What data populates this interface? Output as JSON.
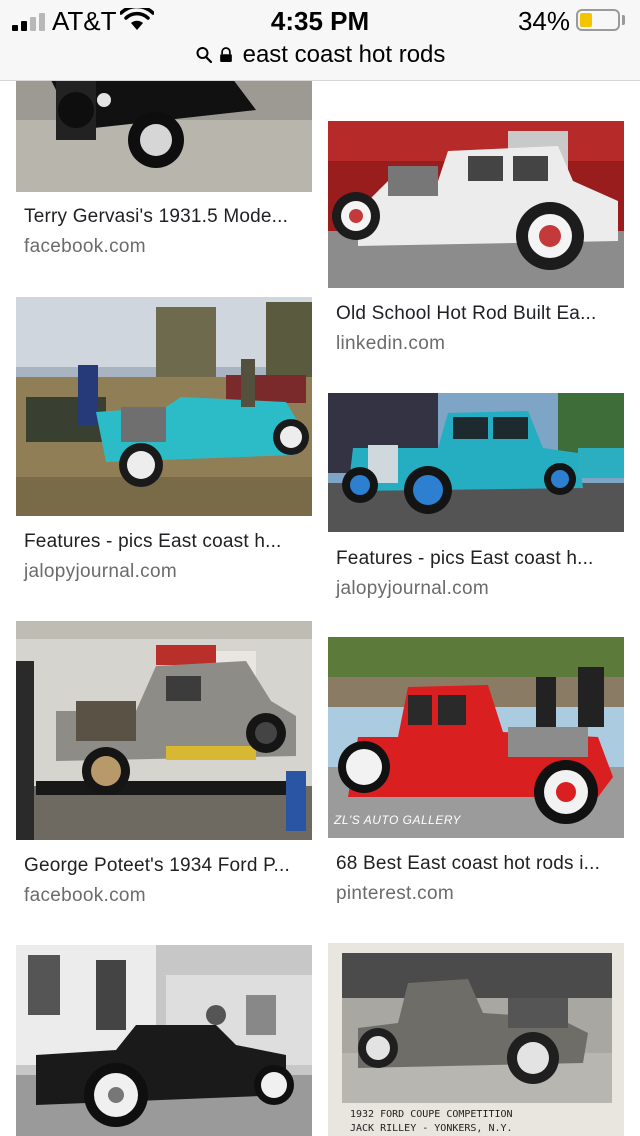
{
  "status_bar": {
    "carrier": "AT&T",
    "time": "4:35 PM",
    "battery_percent": "34%",
    "battery_level": 0.34,
    "battery_color": "#f5c400",
    "signal_bars_active": 2,
    "signal_bars_total": 4,
    "icons": [
      "signal-bars-icon",
      "wifi-icon",
      "battery-icon"
    ]
  },
  "url_bar": {
    "text": "east coast hot rods",
    "icons": [
      "search-icon",
      "lock-icon"
    ]
  },
  "results": [
    {
      "title": "Terry Gervasi's 1931.5 Mode...",
      "source": "facebook.com"
    },
    {
      "title": "Old School Hot Rod Built Ea...",
      "source": "linkedin.com"
    },
    {
      "title": "Features - pics East coast h...",
      "source": "jalopyjournal.com"
    },
    {
      "title": "Features - pics East coast h...",
      "source": "jalopyjournal.com"
    },
    {
      "title": "George Poteet's 1934 Ford P...",
      "source": "facebook.com"
    },
    {
      "title": "68 Best East coast hot rods i...",
      "source": "pinterest.com"
    },
    {
      "title": "",
      "source": ""
    },
    {
      "title": "",
      "source": "",
      "image_caption": [
        "1932 FORD COUPE   COMPETITION",
        "JACK RILLEY - YONKERS, N.Y."
      ]
    }
  ],
  "image_watermarks": {
    "result_5": "ZL'S AUTO GALLERY"
  }
}
